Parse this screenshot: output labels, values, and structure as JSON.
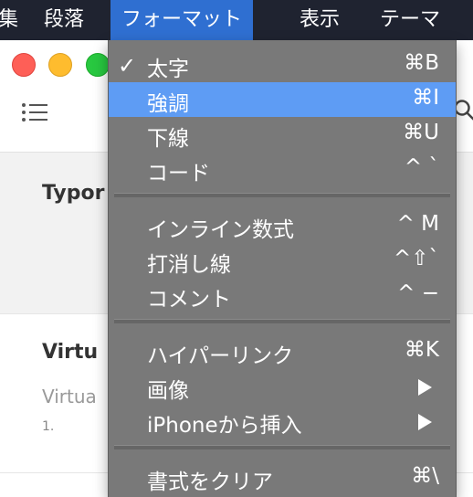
{
  "menubar": {
    "items": [
      {
        "label": "集"
      },
      {
        "label": "段落"
      },
      {
        "label": "フォーマット"
      },
      {
        "label": "表示"
      },
      {
        "label": "テーマ"
      }
    ]
  },
  "window": {
    "files": [
      {
        "title": "Typor"
      },
      {
        "title": "Virtu",
        "preview": "Virtua",
        "num": "1."
      }
    ]
  },
  "menu": {
    "items": [
      {
        "label": "太字",
        "shortcut": "⌘B",
        "checked": "✓"
      },
      {
        "label": "強調",
        "shortcut": "⌘I"
      },
      {
        "label": "下線",
        "shortcut": "⌘U"
      },
      {
        "label": "コード",
        "shortcut": "^ `"
      },
      {
        "label": "インライン数式",
        "shortcut": "^ M"
      },
      {
        "label": "打消し線",
        "shortcut": "^⇧`"
      },
      {
        "label": "コメント",
        "shortcut": "^ −"
      },
      {
        "label": "ハイパーリンク",
        "shortcut": "⌘K"
      },
      {
        "label": "画像",
        "submenu": true
      },
      {
        "label": "iPhoneから挿入",
        "submenu": true
      },
      {
        "label": "書式をクリア",
        "shortcut": "⌘\\"
      }
    ],
    "highlighted_index": 1
  },
  "colors": {
    "menubar": "#1f2330",
    "menubar_active": "#2f6fd1",
    "menu_bg": "#797979",
    "highlight": "#5e9cf4"
  }
}
